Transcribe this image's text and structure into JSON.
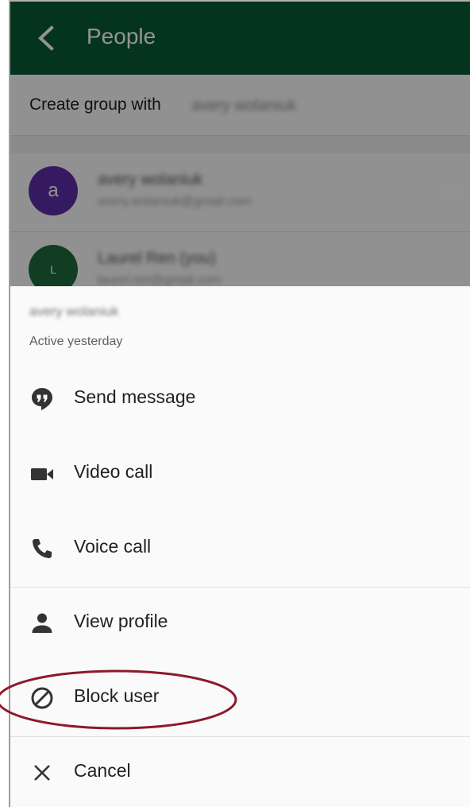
{
  "appbar": {
    "title": "People"
  },
  "create_group": {
    "label": "Create group with",
    "name": "avery wolaniuk"
  },
  "contacts": [
    {
      "initial": "a",
      "name": "avery wolaniuk",
      "detail": "avery.wolaniuk@gmail.com"
    },
    {
      "initial": "L",
      "name": "Laurel Ren (you)",
      "detail": "laurel.ren@gmail.com"
    }
  ],
  "sheet": {
    "name": "avery wolaniuk",
    "status": "Active yesterday",
    "actions": [
      {
        "label": "Send message",
        "icon": "hangouts-quote-icon"
      },
      {
        "label": "Video call",
        "icon": "videocam-icon"
      },
      {
        "label": "Voice call",
        "icon": "phone-icon"
      },
      {
        "label": "View profile",
        "icon": "person-icon"
      },
      {
        "label": "Block user",
        "icon": "block-icon"
      },
      {
        "label": "Cancel",
        "icon": "close-icon"
      }
    ]
  },
  "colors": {
    "appbar": "#0a5a35",
    "avatar_a": "#5e2ea8",
    "avatar_l": "#1e6b3c",
    "annotation": "#8b1a2b",
    "icon": "#333333"
  }
}
